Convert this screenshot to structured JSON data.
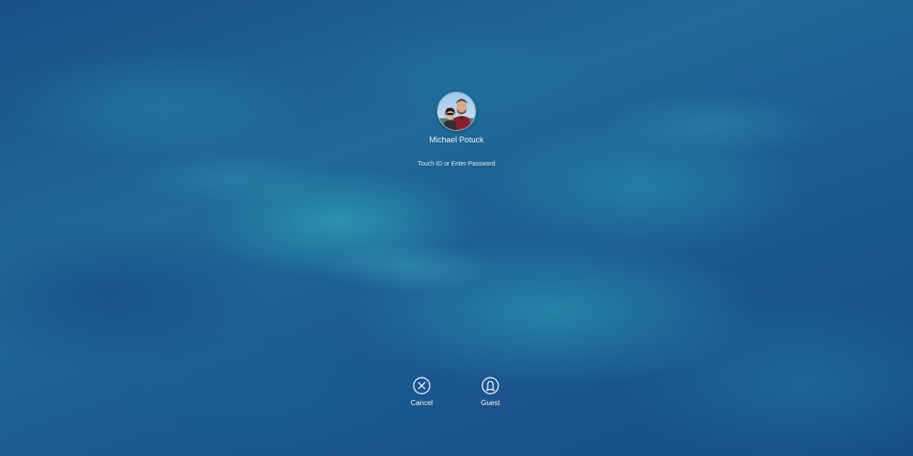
{
  "screen": "macOS login window",
  "user": {
    "name": "Michael Potuck",
    "avatar_icon": "user-avatar-photo"
  },
  "prompt": {
    "hint": "Touch ID or Enter Password"
  },
  "actions": [
    {
      "label": "Cancel",
      "icon": "cancel-circle-x-icon"
    },
    {
      "label": "Guest",
      "icon": "guest-user-icon"
    }
  ],
  "colors": {
    "wallpaper_primary": "#1c5f8f",
    "wallpaper_highlight": "#30aab9",
    "text": "#ffffff"
  }
}
